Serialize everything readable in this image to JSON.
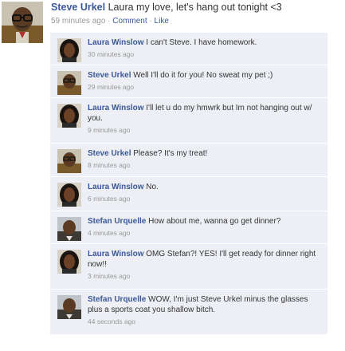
{
  "post": {
    "author": "Steve Urkel",
    "message": "Laura my love, let's hang out tonight <3",
    "time": "59 minutes ago",
    "separator1": " · ",
    "comment_label": "Comment",
    "separator2": " · ",
    "like_label": "Like",
    "avatar_icon": "steve-urkel-avatar-icon"
  },
  "comments": [
    {
      "author": "Laura Winslow",
      "text": "I can't Steve. I have homework.",
      "time": "30 minutes ago",
      "avatar": "laura"
    },
    {
      "author": "Steve Urkel",
      "text": "Well I'll do it for you! No sweat my pet ;)",
      "time": "29 minutes ago",
      "avatar": "steve"
    },
    {
      "author": "Laura Winslow",
      "text": "I'll let u do my hmwrk but Im not hanging out w/ you.",
      "time": "9 minutes ago",
      "avatar": "laura"
    },
    {
      "author": "Steve Urkel",
      "text": "Please? It's my treat!",
      "time": "8 minutes ago",
      "avatar": "steve"
    },
    {
      "author": "Laura Winslow",
      "text": "No.",
      "time": "6 minutes ago",
      "avatar": "laura"
    },
    {
      "author": "Stefan Urquelle",
      "text": "How about me, wanna go get dinner?",
      "time": "4 minutes ago",
      "avatar": "stefan"
    },
    {
      "author": "Laura Winslow",
      "text": "OMG Stefan?! YES! I'll get ready for dinner right now!!",
      "time": "3 minutes ago",
      "avatar": "laura"
    },
    {
      "author": "Stefan Urquelle",
      "text": "WOW, I'm just Steve Urkel minus the glasses plus a sports coat you shallow bitch.",
      "time": "44 seconds ago",
      "avatar": "stefan"
    }
  ],
  "colors": {
    "link": "#3b5998",
    "comment_bg": "#edeff4",
    "meta": "#999999"
  }
}
